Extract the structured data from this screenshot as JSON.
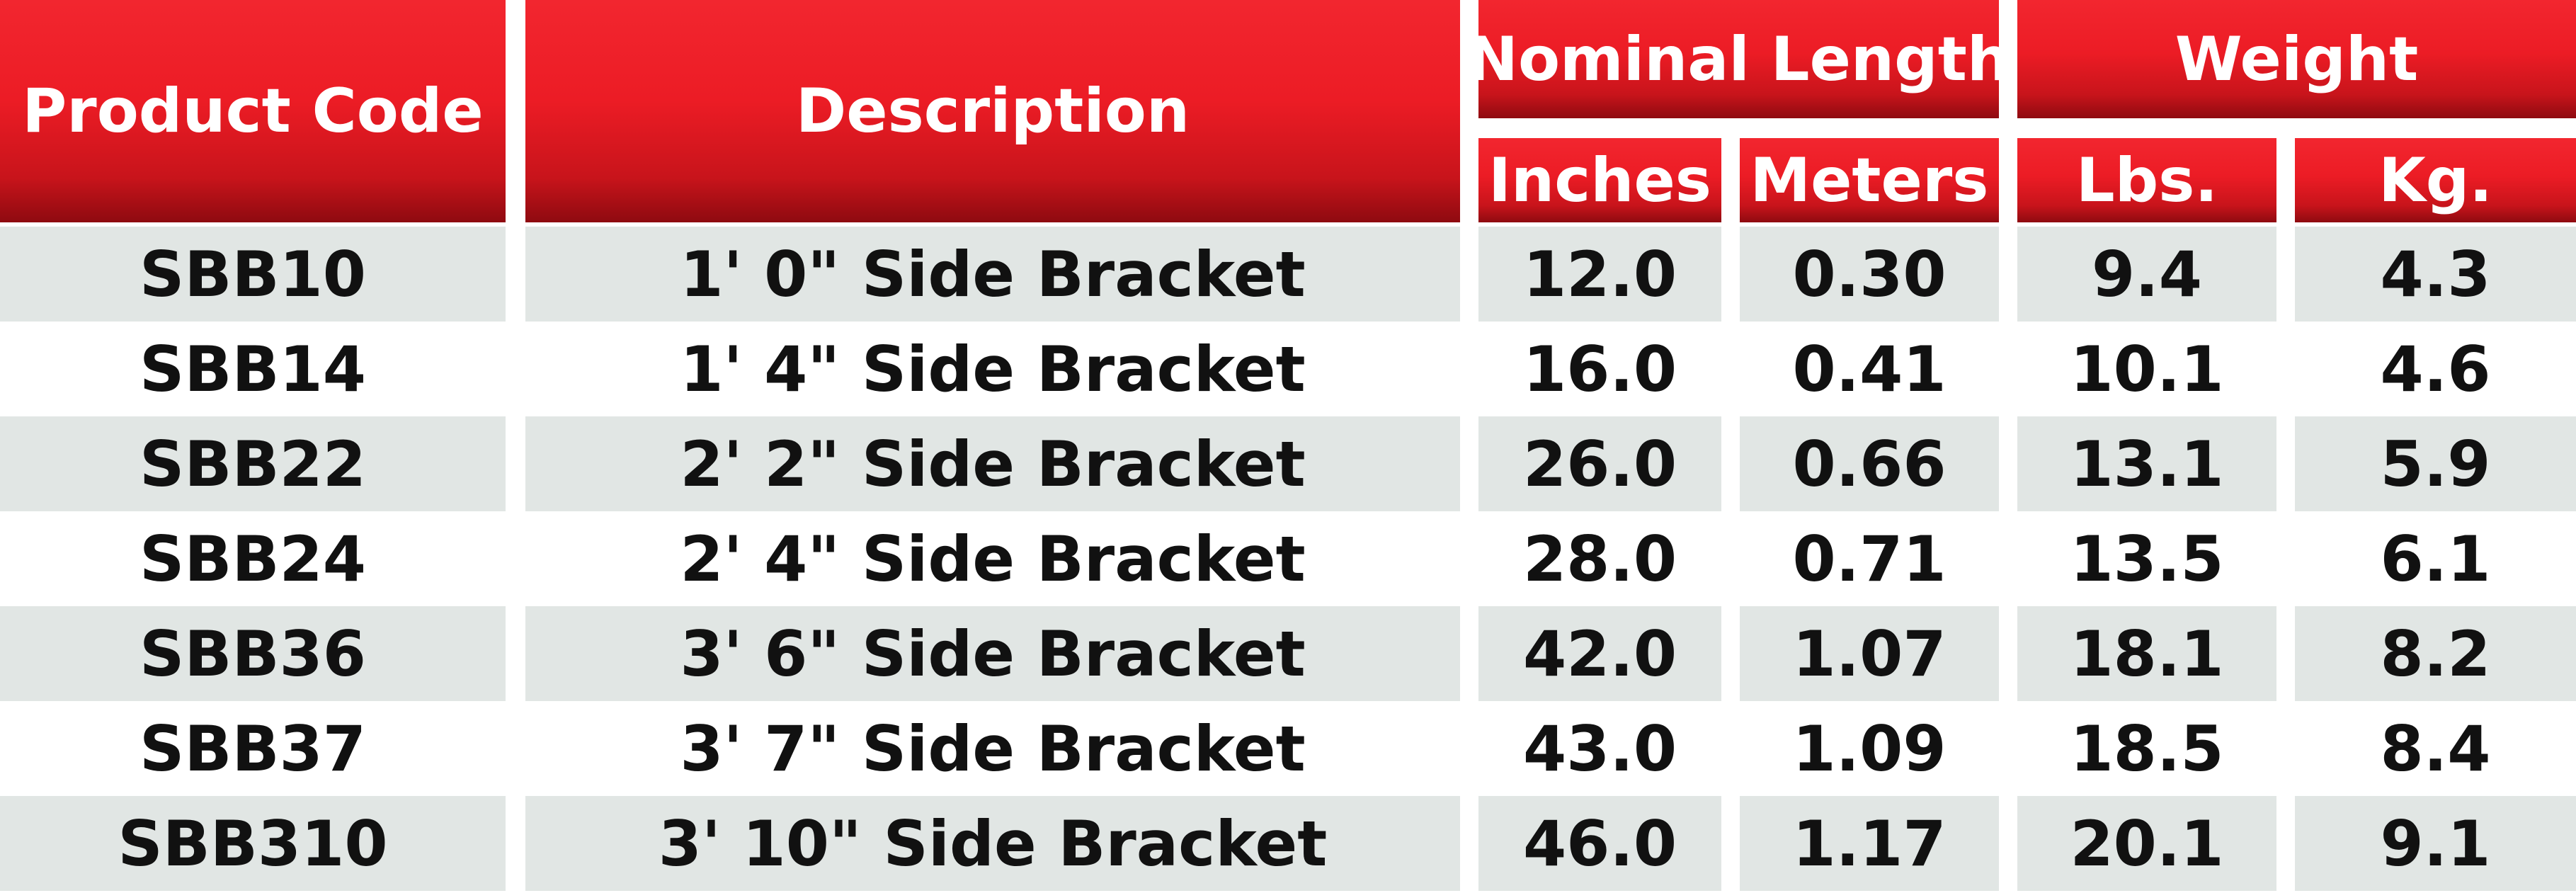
{
  "headers": {
    "product_code": "Product Code",
    "description": "Description",
    "nominal_length": "Nominal Length",
    "weight": "Weight",
    "inches": "Inches",
    "meters": "Meters",
    "lbs": "Lbs.",
    "kg": "Kg."
  },
  "rows": [
    {
      "code": "SBB10",
      "description": "1' 0\" Side Bracket",
      "inches": "12.0",
      "meters": "0.30",
      "lbs": "9.4",
      "kg": "4.3"
    },
    {
      "code": "SBB14",
      "description": "1' 4\" Side Bracket",
      "inches": "16.0",
      "meters": "0.41",
      "lbs": "10.1",
      "kg": "4.6"
    },
    {
      "code": "SBB22",
      "description": "2' 2\" Side Bracket",
      "inches": "26.0",
      "meters": "0.66",
      "lbs": "13.1",
      "kg": "5.9"
    },
    {
      "code": "SBB24",
      "description": "2' 4\" Side Bracket",
      "inches": "28.0",
      "meters": "0.71",
      "lbs": "13.5",
      "kg": "6.1"
    },
    {
      "code": "SBB36",
      "description": "3' 6\" Side Bracket",
      "inches": "42.0",
      "meters": "1.07",
      "lbs": "18.1",
      "kg": "8.2"
    },
    {
      "code": "SBB37",
      "description": "3' 7\" Side Bracket",
      "inches": "43.0",
      "meters": "1.09",
      "lbs": "18.5",
      "kg": "8.4"
    },
    {
      "code": "SBB310",
      "description": "3' 10\" Side Bracket",
      "inches": "46.0",
      "meters": "1.17",
      "lbs": "20.1",
      "kg": "9.1"
    }
  ],
  "colors": {
    "header_red": "#ec1c25",
    "header_text": "#ffffff",
    "band_gray": "#e1e6e4",
    "band_white": "#ffffff",
    "cell_text": "#111111"
  }
}
